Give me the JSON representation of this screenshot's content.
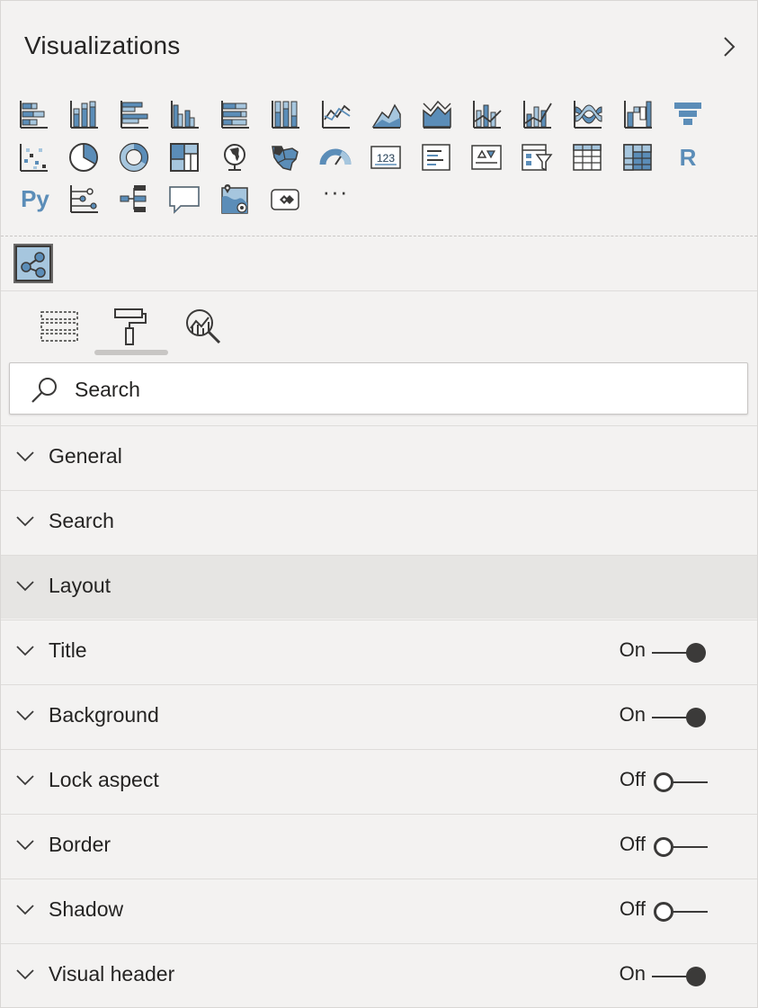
{
  "pane": {
    "title": "Visualizations",
    "collapse_icon": "chevron-right-icon"
  },
  "visuals": {
    "row1": [
      "stacked-bar-chart-icon",
      "stacked-column-chart-icon",
      "clustered-bar-chart-icon",
      "clustered-column-chart-icon",
      "100-stacked-bar-chart-icon",
      "100-stacked-column-chart-icon",
      "line-chart-icon",
      "area-chart-icon",
      "stacked-area-chart-icon",
      "line-and-stacked-column-chart-icon",
      "line-and-clustered-column-chart-icon",
      "ribbon-chart-icon",
      "waterfall-chart-icon",
      "funnel-icon"
    ],
    "row2": [
      "scatter-chart-icon",
      "pie-chart-icon",
      "donut-chart-icon",
      "treemap-icon",
      "map-icon",
      "filled-map-icon",
      "gauge-icon",
      "card-icon",
      "multi-row-card-icon",
      "kpi-icon",
      "slicer-icon",
      "table-icon",
      "matrix-icon",
      "r-script-visual-icon"
    ],
    "row3": [
      "python-visual-icon",
      "key-influencers-icon",
      "decomposition-tree-icon",
      "qna-icon",
      "shape-map-icon",
      "power-apps-icon",
      "more-options-icon"
    ],
    "r_label": "R",
    "py_label": "Py",
    "more_label": "···",
    "custom_visual_icon": "network-graph-icon"
  },
  "tabs": [
    {
      "name": "fields-tab",
      "icon": "fields-icon"
    },
    {
      "name": "format-tab",
      "icon": "paint-roller-icon",
      "selected": true
    },
    {
      "name": "analytics-tab",
      "icon": "analytics-magnifier-icon"
    }
  ],
  "search": {
    "placeholder": "Search",
    "icon": "search-icon"
  },
  "sections": [
    {
      "label": "General"
    },
    {
      "label": "Search"
    },
    {
      "label": "Layout"
    },
    {
      "label": "Title",
      "state": "On"
    },
    {
      "label": "Background",
      "state": "On"
    },
    {
      "label": "Lock aspect",
      "state": "Off"
    },
    {
      "label": "Border",
      "state": "Off"
    },
    {
      "label": "Shadow",
      "state": "Off"
    },
    {
      "label": "Visual header",
      "state": "On"
    }
  ],
  "colors": {
    "icon_blue": "#5b8db8",
    "icon_light_blue": "#a6c6de",
    "icon_dark": "#3b3a39",
    "toggle": "#3b3a39"
  }
}
